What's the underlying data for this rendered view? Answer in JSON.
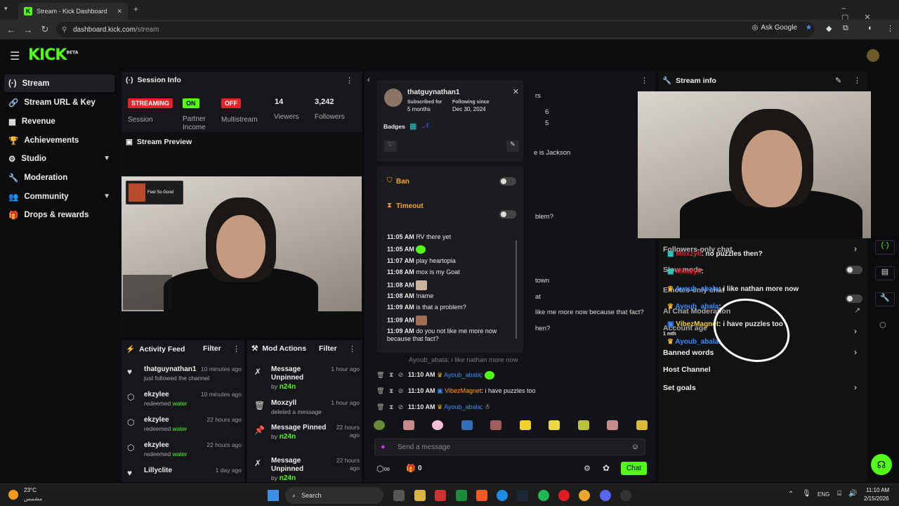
{
  "browser": {
    "tab_title": "Stream - Kick Dashboard",
    "url_host": "dashboard.kick.com",
    "url_path": "/stream",
    "ask_google": "Ask Google"
  },
  "app": {
    "logo": "KICK",
    "logo_sup": "BETA"
  },
  "sidebar": {
    "items": [
      {
        "label": "Stream",
        "icon": "broadcast-icon"
      },
      {
        "label": "Stream URL & Key",
        "icon": "link-icon"
      },
      {
        "label": "Revenue",
        "icon": "chart-icon"
      },
      {
        "label": "Achievements",
        "icon": "trophy-icon"
      },
      {
        "label": "Studio",
        "icon": "studio-icon"
      },
      {
        "label": "Moderation",
        "icon": "wrench-icon"
      },
      {
        "label": "Community",
        "icon": "people-icon"
      },
      {
        "label": "Drops & rewards",
        "icon": "gift-icon"
      }
    ]
  },
  "session": {
    "title": "Session Info",
    "streaming": "STREAMING",
    "on": "ON",
    "off": "OFF",
    "session_label": "Session",
    "partner_label": "Partner Income",
    "multistream_label": "Multistream",
    "viewers_value": "14",
    "viewers_label": "Viewers",
    "followers_value": "3,242",
    "followers_label": "Followers"
  },
  "preview": {
    "title": "Stream Preview",
    "overlay_title": "Feel So Good"
  },
  "activity": {
    "title": "Activity Feed",
    "filter": "Filter",
    "items": [
      {
        "name": "thatguynathan1",
        "sub": "just followed the channel",
        "time": "10 minutes ago"
      },
      {
        "name": "ekzylee",
        "sub": "redeemed",
        "reward": "water",
        "time": "10 minutes ago"
      },
      {
        "name": "ekzylee",
        "sub": "redeemed",
        "reward": "water",
        "time": "22 hours ago"
      },
      {
        "name": "ekzylee",
        "sub": "redeemed",
        "reward": "water",
        "time": "22 hours ago"
      },
      {
        "name": "Lillyclite",
        "sub": "",
        "time": "1 day ago"
      }
    ]
  },
  "modactions": {
    "title": "Mod Actions",
    "filter": "Filter",
    "items": [
      {
        "action": "Message Unpinned",
        "by": "by",
        "mod": "n24n",
        "time": "1 hour ago"
      },
      {
        "action": "Moxzyll",
        "by": "deleted a message",
        "mod": "",
        "time": "1 hour ago"
      },
      {
        "action": "Message Pinned",
        "by": "by",
        "mod": "n24n",
        "time": "22 hours ago"
      },
      {
        "action": "Message Unpinned",
        "by": "by",
        "mod": "n24n",
        "time": "22 hours ago"
      }
    ]
  },
  "usercard": {
    "username": "thatguynathan1",
    "subscribed_label": "Subscribed for",
    "subscribed_value": "5 months",
    "following_label": "Following since",
    "following_value": "Dec 30, 2024",
    "badges_label": "Badges",
    "ban": "Ban",
    "timeout": "Timeout",
    "history": [
      {
        "time": "11:05 AM",
        "text": "RV there yet"
      },
      {
        "time": "11:05 AM",
        "text": ""
      },
      {
        "time": "11:07 AM",
        "text": "play heartopia"
      },
      {
        "time": "11:08 AM",
        "text": "mox is my Goat"
      },
      {
        "time": "11:08 AM",
        "text": ""
      },
      {
        "time": "11:08 AM",
        "text": "!name"
      },
      {
        "time": "11:09 AM",
        "text": "is that a problem?"
      },
      {
        "time": "11:09 AM",
        "text": ""
      },
      {
        "time": "11:09 AM",
        "text": "do you not like me more now because that fact?"
      }
    ]
  },
  "chat": {
    "bg_fragments": [
      "rs",
      "6",
      "5",
      "e is Jackson",
      "blem?",
      "town",
      "at",
      "like me more now because that fact?",
      "hen?",
      "Ayoub_abala: i like nathan more now"
    ],
    "messages": [
      {
        "time": "11:10 AM",
        "user": "Ayoub_abala",
        "text": ""
      },
      {
        "time": "11:10 AM",
        "user": "VibezMagnet",
        "text": "i have puzzles too"
      },
      {
        "time": "11:10 AM",
        "user": "Ayoub_abala",
        "text": ""
      }
    ],
    "placeholder": "Send a message",
    "count": "0",
    "send": "Chat"
  },
  "streaminfo": {
    "title": "Stream info",
    "rows": [
      "Followers-only chat",
      "Slow mode",
      "Emotes-only chat",
      "AI Chat Moderation",
      "Account age",
      "Banned words",
      "Host Channel",
      "Set goals"
    ],
    "overlay_messages": [
      {
        "user": "Moxzyll",
        "text": "no puzzles then?"
      },
      {
        "user": "Moxzyll",
        "text": ""
      },
      {
        "user": "Ayoub_abala",
        "text": "i like nathan more now"
      },
      {
        "user": "Ayoub_abala",
        "text": ""
      },
      {
        "user": "VibezMagnet",
        "text": "i have puzzles too"
      },
      {
        "user": "Ayoub_abala",
        "text": ""
      }
    ],
    "overlay_sub": "1 mth"
  },
  "taskbar": {
    "weather_temp": "23°C",
    "weather_desc": "مشمس",
    "search": "Search",
    "lang": "ENG",
    "time": "11:10 AM",
    "date": "2/15/2026"
  },
  "colors": {
    "kick_green": "#53fc18",
    "streaming_red": "#e5212b",
    "link_blue": "#3b8cff"
  }
}
